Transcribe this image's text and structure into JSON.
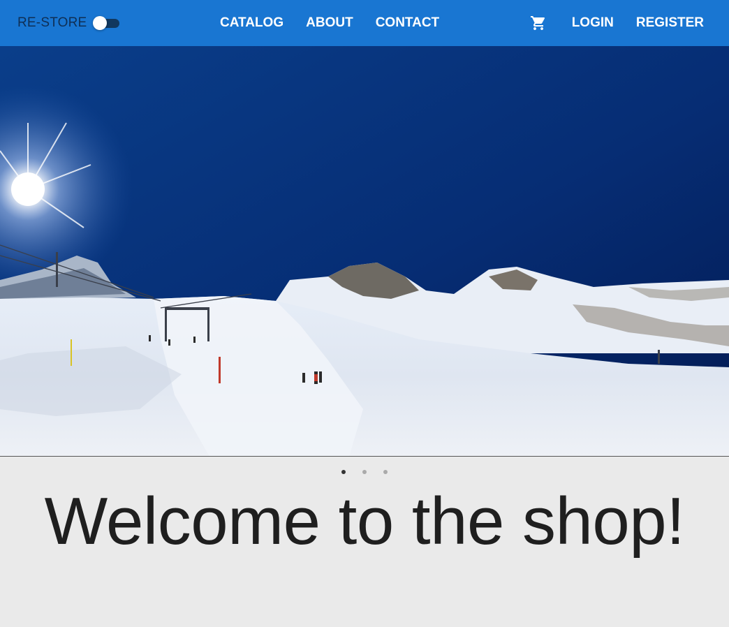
{
  "header": {
    "brand": "RE-STORE",
    "nav_links": [
      "CATALOG",
      "ABOUT",
      "CONTACT"
    ],
    "cart_icon": "shopping-cart-icon",
    "login_label": "LOGIN",
    "register_label": "REGISTER",
    "dark_mode_enabled": false
  },
  "hero": {
    "image": "snowy mountain ski slope under a deep blue sky with sun",
    "carousel_pages": 3,
    "carousel_active_index": 0
  },
  "main": {
    "heading": "Welcome to the shop!"
  },
  "colors": {
    "appbar": "#1976d2",
    "brand_text": "#0f2f55",
    "page_background": "#eaeaea"
  }
}
